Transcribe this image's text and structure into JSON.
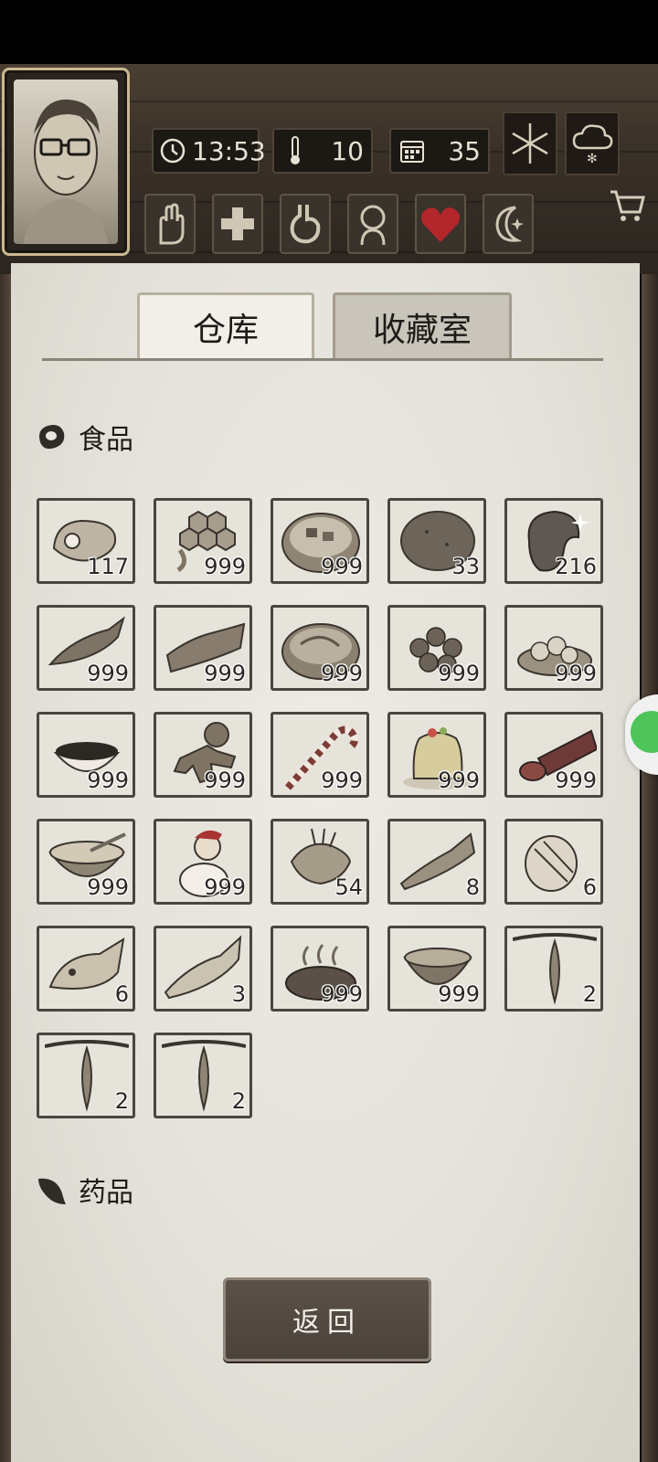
{
  "header": {
    "clock": "13:53",
    "temperature": "10",
    "day": "35"
  },
  "status_icons": [
    "hand-icon",
    "plus-icon",
    "stomach-icon",
    "head-icon",
    "heart-icon",
    "moon-icon"
  ],
  "tabs": [
    {
      "label": "仓库",
      "active": true
    },
    {
      "label": "收藏室",
      "active": false
    }
  ],
  "sections": {
    "food": {
      "label": "食品"
    },
    "medicine": {
      "label": "药品"
    }
  },
  "items": [
    {
      "icon": "steak-icon",
      "count": "117"
    },
    {
      "icon": "honeycomb-icon",
      "count": "999"
    },
    {
      "icon": "stew-bowl-icon",
      "count": "999"
    },
    {
      "icon": "potato-icon",
      "count": "33"
    },
    {
      "icon": "bean-icon",
      "count": "216"
    },
    {
      "icon": "dried-fish-icon",
      "count": "999"
    },
    {
      "icon": "bacon-icon",
      "count": "999"
    },
    {
      "icon": "noodle-bowl-icon",
      "count": "999"
    },
    {
      "icon": "meatballs-icon",
      "count": "999"
    },
    {
      "icon": "dumplings-plate-icon",
      "count": "999"
    },
    {
      "icon": "berry-bowl-icon",
      "count": "999"
    },
    {
      "icon": "gingerbread-man-icon",
      "count": "999"
    },
    {
      "icon": "candy-cane-icon",
      "count": "999"
    },
    {
      "icon": "jelly-cake-icon",
      "count": "999"
    },
    {
      "icon": "sausage-icon",
      "count": "999"
    },
    {
      "icon": "porridge-bowl-icon",
      "count": "999"
    },
    {
      "icon": "santa-cookie-icon",
      "count": "999"
    },
    {
      "icon": "lionfish-icon",
      "count": "54"
    },
    {
      "icon": "salmon-icon",
      "count": "8"
    },
    {
      "icon": "butterflyfish-icon",
      "count": "6"
    },
    {
      "icon": "grouper-icon",
      "count": "6"
    },
    {
      "icon": "tuna-icon",
      "count": "3"
    },
    {
      "icon": "grilled-meat-icon",
      "count": "999"
    },
    {
      "icon": "hot-soup-bowl-icon",
      "count": "999"
    },
    {
      "icon": "hanging-fruit-icon",
      "count": "2"
    },
    {
      "icon": "hanging-fruit-icon",
      "count": "2"
    },
    {
      "icon": "hanging-fruit-icon",
      "count": "2"
    }
  ],
  "back_button": {
    "label": "返回"
  },
  "colors": {
    "paper": "#e8e6df",
    "slot_border": "#4a4541",
    "heart": "#b3262b"
  }
}
